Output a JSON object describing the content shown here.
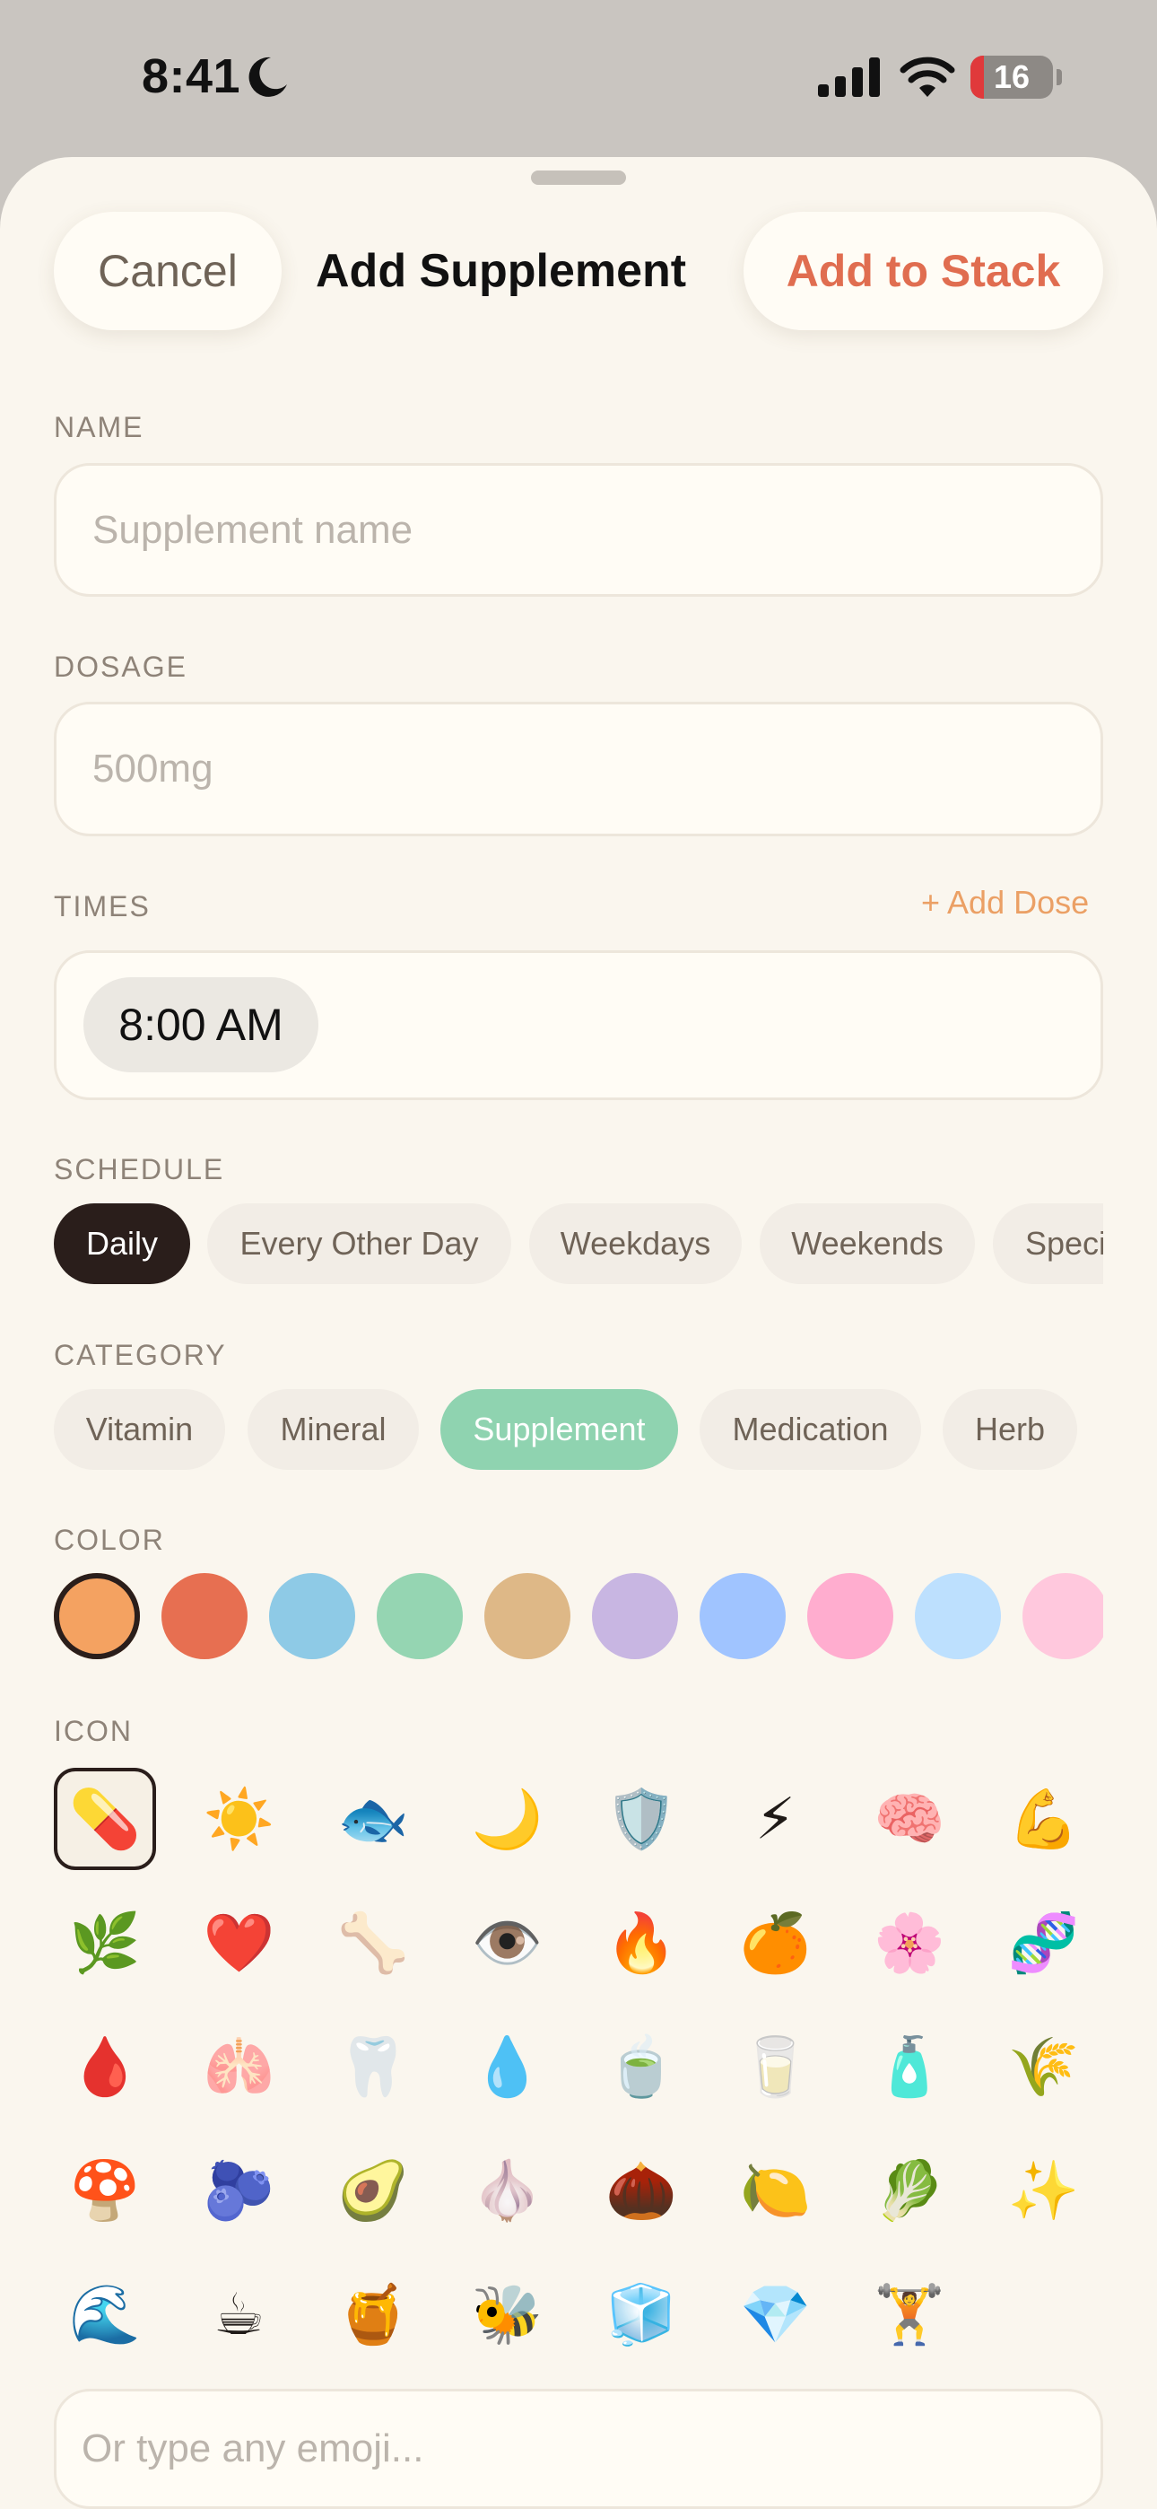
{
  "status_bar": {
    "time": "8:41",
    "battery_level": "16",
    "battery_fraction": 0.16,
    "icons": [
      "moon-icon",
      "signal-icon",
      "wifi-icon",
      "battery-icon"
    ]
  },
  "header": {
    "cancel_label": "Cancel",
    "title": "Add Supplement",
    "add_label": "Add to Stack"
  },
  "name_section": {
    "label": "NAME",
    "value": "",
    "placeholder": "Supplement name"
  },
  "dosage_section": {
    "label": "DOSAGE",
    "value": "",
    "placeholder": "500mg"
  },
  "times_section": {
    "label": "TIMES",
    "add_dose_label": "+ Add Dose",
    "times": [
      "8:00 AM"
    ]
  },
  "schedule_section": {
    "label": "SCHEDULE",
    "selected": "Daily",
    "options": [
      "Daily",
      "Every Other Day",
      "Weekdays",
      "Weekends",
      "Speci"
    ]
  },
  "category_section": {
    "label": "CATEGORY",
    "selected": "Supplement",
    "options": [
      "Vitamin",
      "Mineral",
      "Supplement",
      "Medication",
      "Herb"
    ]
  },
  "color_section": {
    "label": "COLOR",
    "selected_index": 0,
    "colors": [
      "#f4a261",
      "#e76f51",
      "#8ecae6",
      "#95d5b2",
      "#deb887",
      "#c8b6e2",
      "#a0c4ff",
      "#ffadcf",
      "#bde0fe",
      "#ffc8dd"
    ]
  },
  "icon_section": {
    "label": "ICON",
    "selected_index": 0,
    "icons": [
      {
        "emoji": "💊",
        "name": "pill-icon"
      },
      {
        "emoji": "☀️",
        "name": "sun-icon"
      },
      {
        "emoji": "🐟",
        "name": "fish-icon"
      },
      {
        "emoji": "🌙",
        "name": "crescent-moon-icon"
      },
      {
        "emoji": "🛡️",
        "name": "shield-icon"
      },
      {
        "emoji": "⚡",
        "name": "lightning-icon"
      },
      {
        "emoji": "🧠",
        "name": "brain-icon"
      },
      {
        "emoji": "💪",
        "name": "flexed-bicep-icon"
      },
      {
        "emoji": "🌿",
        "name": "herb-icon"
      },
      {
        "emoji": "❤️",
        "name": "heart-icon"
      },
      {
        "emoji": "🦴",
        "name": "bone-icon"
      },
      {
        "emoji": "👁️",
        "name": "eye-icon"
      },
      {
        "emoji": "🔥",
        "name": "fire-icon"
      },
      {
        "emoji": "🍊",
        "name": "orange-icon"
      },
      {
        "emoji": "🌸",
        "name": "cherry-blossom-icon"
      },
      {
        "emoji": "🧬",
        "name": "dna-icon"
      },
      {
        "emoji": "🩸",
        "name": "blood-drop-icon"
      },
      {
        "emoji": "🫁",
        "name": "lungs-icon"
      },
      {
        "emoji": "🦷",
        "name": "tooth-icon"
      },
      {
        "emoji": "💧",
        "name": "water-drop-icon"
      },
      {
        "emoji": "🍵",
        "name": "tea-icon"
      },
      {
        "emoji": "🥛",
        "name": "milk-icon"
      },
      {
        "emoji": "🧴",
        "name": "lotion-bottle-icon"
      },
      {
        "emoji": "🌾",
        "name": "rice-plant-icon"
      },
      {
        "emoji": "🍄",
        "name": "mushroom-icon"
      },
      {
        "emoji": "🫐",
        "name": "blueberries-icon"
      },
      {
        "emoji": "🥑",
        "name": "avocado-icon"
      },
      {
        "emoji": "🧄",
        "name": "garlic-icon"
      },
      {
        "emoji": "🌰",
        "name": "chestnut-icon"
      },
      {
        "emoji": "🍋",
        "name": "lemon-icon"
      },
      {
        "emoji": "🥬",
        "name": "leafy-green-icon"
      },
      {
        "emoji": "✨",
        "name": "sparkles-icon"
      },
      {
        "emoji": "🌊",
        "name": "wave-icon"
      },
      {
        "emoji": "☕",
        "name": "coffee-icon"
      },
      {
        "emoji": "🍯",
        "name": "honey-pot-icon"
      },
      {
        "emoji": "🐝",
        "name": "bee-icon"
      },
      {
        "emoji": "🧊",
        "name": "ice-cube-icon"
      },
      {
        "emoji": "💎",
        "name": "gem-icon"
      },
      {
        "emoji": "🏋️",
        "name": "weightlifter-icon"
      }
    ]
  },
  "emoji_input": {
    "value": "",
    "placeholder": "Or type any emoji..."
  }
}
